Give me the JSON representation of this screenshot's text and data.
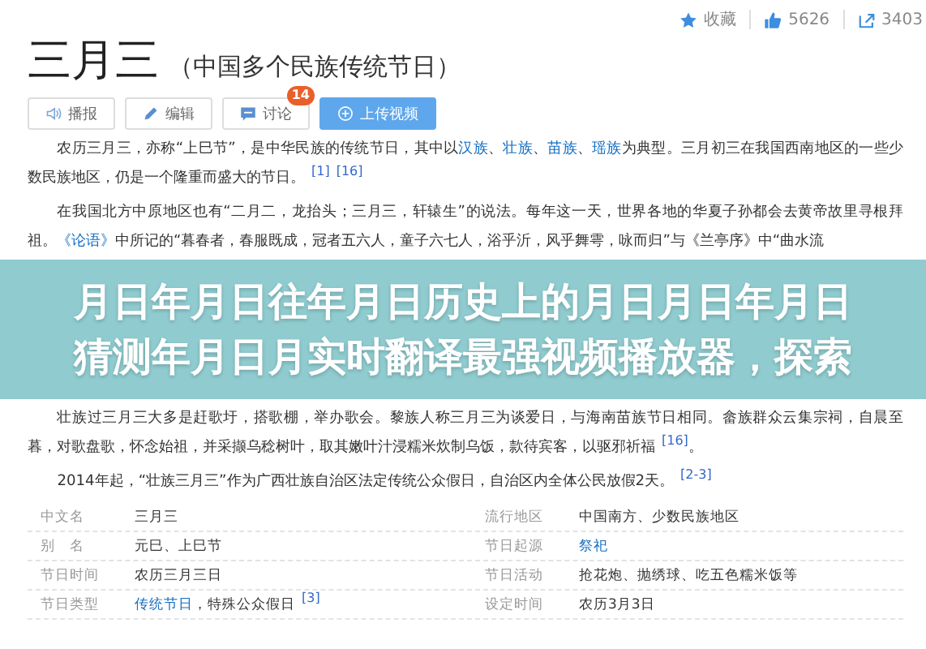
{
  "actions": [
    {
      "kind": "star",
      "label": "收藏"
    },
    {
      "kind": "thumb",
      "label": "5626"
    },
    {
      "kind": "share",
      "label": "3403"
    }
  ],
  "title": {
    "main": "三月三",
    "sub": "（中国多个民族传统节日）"
  },
  "buttons": [
    {
      "kind": "speaker",
      "label": "播报",
      "primary": false
    },
    {
      "kind": "pencil",
      "label": "编辑",
      "primary": false
    },
    {
      "kind": "chat",
      "label": "讨论",
      "primary": false,
      "badge": "14"
    },
    {
      "kind": "plus",
      "label": "上传视频",
      "primary": true
    }
  ],
  "paragraphs": [
    [
      {
        "kind": "text",
        "text": "农历三月三，亦称“上巳节”，是中华民族的传统节日，其中以"
      },
      {
        "kind": "link",
        "text": "汉族"
      },
      {
        "kind": "text",
        "text": "、"
      },
      {
        "kind": "link",
        "text": "壮族"
      },
      {
        "kind": "text",
        "text": "、"
      },
      {
        "kind": "link",
        "text": "苗族"
      },
      {
        "kind": "text",
        "text": "、"
      },
      {
        "kind": "link",
        "text": "瑶族"
      },
      {
        "kind": "text",
        "text": "为典型。三月初三在我国西南地区的一些少数民族地区，仍是一个隆重而盛大的节日。"
      },
      {
        "kind": "ref",
        "text": "[1]"
      },
      {
        "kind": "ref",
        "text": "[16]"
      }
    ],
    [
      {
        "kind": "text",
        "text": "在我国北方中原地区也有“二月二，龙抬头；三月三，轩辕生”的说法。每年这一天，世界各地的华夏子孙都会去黄帝故里寻根拜祖。"
      },
      {
        "kind": "link",
        "text": "《论语》"
      },
      {
        "kind": "text",
        "text": "中所记的“暮春者，春服既成，冠者五六人，童子六七人，浴乎沂，风乎舞雩，咏而归”与《兰亭序》中“曲水流"
      }
    ],
    [
      {
        "kind": "text",
        "text": "壮族过三月三大多是赶歌圩，搭歌棚，举办歌会。黎族人称三月三为谈爱日，与海南苗族节日相同。畲族群众云集宗祠，自晨至暮，对歌盘歌，怀念始祖，并采撷乌稔树叶，取其嫩叶汁浸糯米炊制乌饭，款待宾客，以驱邪祈福"
      },
      {
        "kind": "ref",
        "text": "[16]"
      },
      {
        "kind": "text",
        "text": "。"
      }
    ],
    [
      {
        "kind": "text",
        "text": "2014年起，“壮族三月三”作为广西壮族自治区法定传统公众假日，自治区内全体公民放假2天。"
      },
      {
        "kind": "ref",
        "text": "[2-3]"
      }
    ]
  ],
  "infobox": [
    [
      {
        "name": "中文名",
        "value": [
          {
            "kind": "text",
            "text": "三月三"
          }
        ]
      },
      {
        "name": "流行地区",
        "value": [
          {
            "kind": "text",
            "text": "中国南方、少数民族地区"
          }
        ]
      }
    ],
    [
      {
        "name": "别　名",
        "value": [
          {
            "kind": "text",
            "text": "元巳、上巳节"
          }
        ]
      },
      {
        "name": "节日起源",
        "value": [
          {
            "kind": "link",
            "text": "祭祀"
          }
        ]
      }
    ],
    [
      {
        "name": "节日时间",
        "value": [
          {
            "kind": "text",
            "text": "农历三月三日"
          }
        ]
      },
      {
        "name": "节日活动",
        "value": [
          {
            "kind": "text",
            "text": "抢花炮、抛绣球、吃五色糯米饭等"
          }
        ]
      }
    ],
    [
      {
        "name": "节日类型",
        "value": [
          {
            "kind": "link",
            "text": "传统节日"
          },
          {
            "kind": "text",
            "text": "，特殊公众假日"
          },
          {
            "kind": "ref",
            "text": "[3]"
          }
        ]
      },
      {
        "name": "设定时间",
        "value": [
          {
            "kind": "text",
            "text": "农历3月3日"
          }
        ]
      }
    ]
  ],
  "banner": {
    "lines": [
      "月日年月日往年月日历史上的月日月日年月日",
      "猜测年月日月实时翻译最强视频播放器，探索"
    ]
  }
}
